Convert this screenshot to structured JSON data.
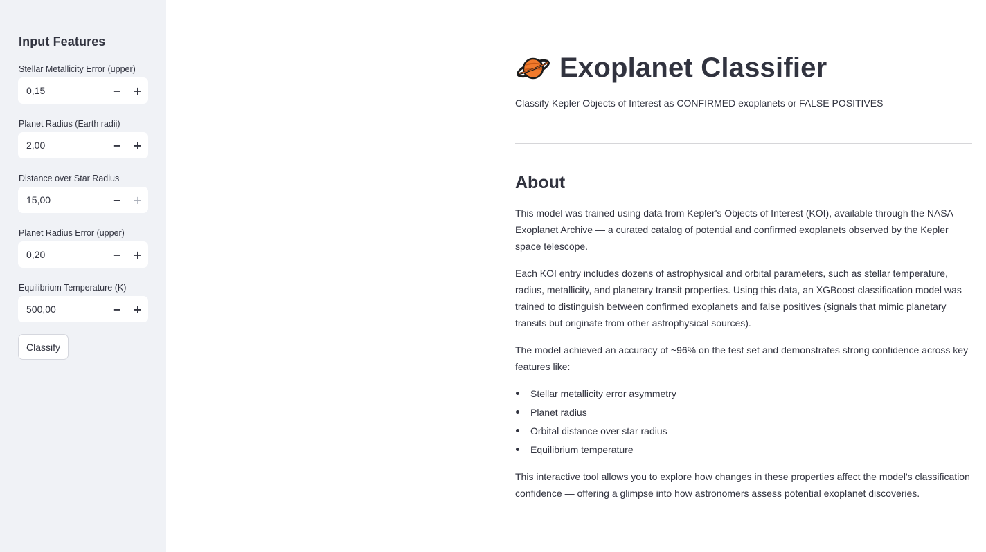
{
  "sidebar": {
    "title": "Input Features",
    "fields": [
      {
        "label": "Stellar Metallicity Error (upper)",
        "value": "0,15",
        "minus": "−",
        "plus": "+"
      },
      {
        "label": "Planet Radius (Earth radii)",
        "value": "2,00",
        "minus": "−",
        "plus": "+"
      },
      {
        "label": "Distance over Star Radius",
        "value": "15,00",
        "minus": "−",
        "plus": "+"
      },
      {
        "label": "Planet Radius Error (upper)",
        "value": "0,20",
        "minus": "−",
        "plus": "+"
      },
      {
        "label": "Equilibrium Temperature (K)",
        "value": "500,00",
        "minus": "−",
        "plus": "+"
      }
    ],
    "classify_label": "Classify"
  },
  "main": {
    "icon": "ringed-planet-icon",
    "title": "Exoplanet Classifier",
    "subtitle": "Classify Kepler Objects of Interest as CONFIRMED exoplanets or FALSE POSITIVES",
    "about_heading": "About",
    "paragraphs": [
      "This model was trained using data from Kepler's Objects of Interest (KOI), available through the NASA Exoplanet Archive — a curated catalog of potential and confirmed exoplanets observed by the Kepler space telescope.",
      "Each KOI entry includes dozens of astrophysical and orbital parameters, such as stellar temperature, radius, metallicity, and planetary transit properties. Using this data, an XGBoost classification model was trained to distinguish between confirmed exoplanets and false positives (signals that mimic planetary transits but originate from other astrophysical sources).",
      "The model achieved an accuracy of ~96% on the test set and demonstrates strong confidence across key features like:",
      "This interactive tool allows you to explore how changes in these properties affect the model's classification confidence — offering a glimpse into how astronomers assess potential exoplanet discoveries."
    ],
    "features": [
      "Stellar metallicity error asymmetry",
      "Planet radius",
      "Orbital distance over star radius",
      "Equilibrium temperature"
    ]
  },
  "colors": {
    "sidebar_bg": "#f0f2f6",
    "text": "#31333f",
    "planet_orange": "#f07a2c",
    "planet_ring": "#1b1b1b"
  }
}
